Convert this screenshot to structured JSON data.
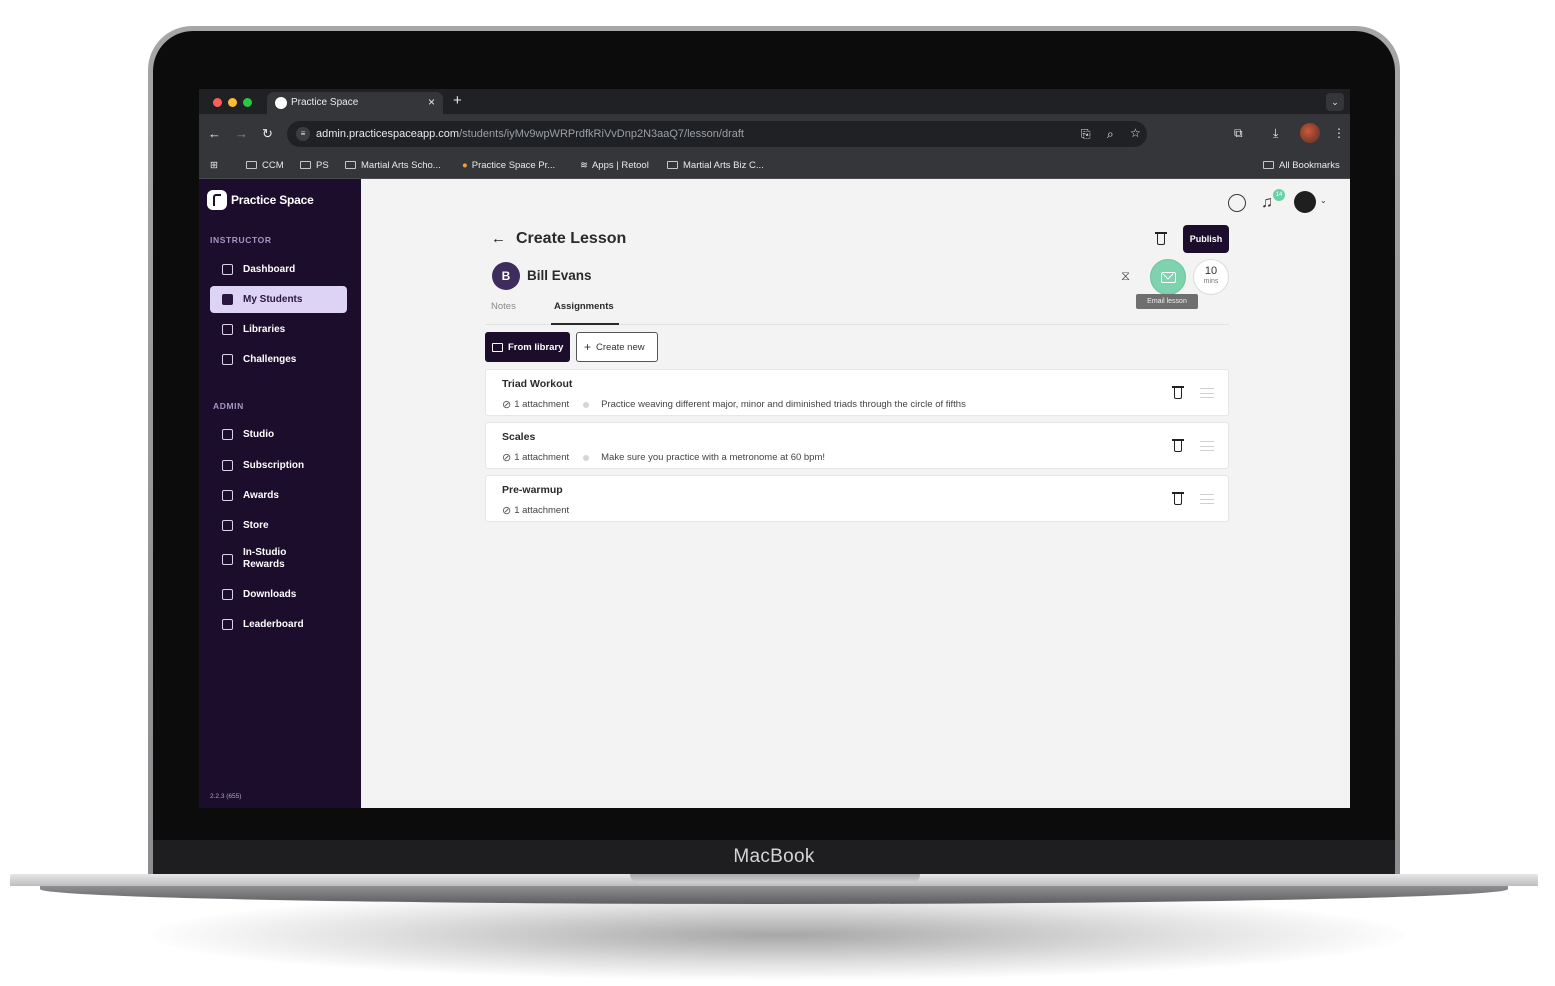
{
  "device": {
    "label": "MacBook"
  },
  "browser": {
    "tab_title": "Practice Space",
    "url_host": "admin.practicespaceapp.com",
    "url_path": "/students/iyMv9wpWRPrdfkRiVvDnp2N3aaQ7/lesson/draft",
    "bookmarks": [
      "CCM",
      "PS",
      "Martial Arts Scho...",
      "Practice Space Pr...",
      "Apps | Retool",
      "Martial Arts Biz C..."
    ],
    "all_bookmarks": "All Bookmarks"
  },
  "sidebar": {
    "brand": "Practice Space",
    "instructor_label": "INSTRUCTOR",
    "instructor_items": [
      {
        "label": "Dashboard",
        "active": false
      },
      {
        "label": "My Students",
        "active": true
      },
      {
        "label": "Libraries",
        "active": false
      },
      {
        "label": "Challenges",
        "active": false
      }
    ],
    "admin_label": "ADMIN",
    "admin_items": [
      {
        "label": "Studio"
      },
      {
        "label": "Subscription"
      },
      {
        "label": "Awards"
      },
      {
        "label": "Store"
      },
      {
        "label": "In-Studio Rewards"
      },
      {
        "label": "Downloads"
      },
      {
        "label": "Leaderboard"
      }
    ],
    "version": "2.2.3 (655)"
  },
  "header": {
    "notification_count": "14"
  },
  "lesson": {
    "title": "Create Lesson",
    "publish_label": "Publish",
    "student_initial": "B",
    "student_name": "Bill Evans",
    "email_tooltip": "Email lesson",
    "duration_value": "10",
    "duration_unit": "mins",
    "tabs": [
      "Notes",
      "Assignments"
    ],
    "active_tab": "Assignments",
    "from_library_label": "From library",
    "create_new_label": "Create new",
    "assignments": [
      {
        "title": "Triad Workout",
        "attachments": "1 attachment",
        "note": "Practice weaving different major, minor and diminished triads through the circle of fifths"
      },
      {
        "title": "Scales",
        "attachments": "1 attachment",
        "note": "Make sure you practice with a metronome at 60 bpm!"
      },
      {
        "title": "Pre-warmup",
        "attachments": "1 attachment",
        "note": ""
      }
    ]
  },
  "colors": {
    "sidebar_bg": "#1b0d2b",
    "active_nav": "#ddd3f4",
    "email_button": "#7ed2ad",
    "publish_button": "#1b0d2b"
  }
}
